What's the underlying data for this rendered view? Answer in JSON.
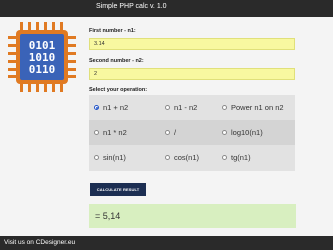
{
  "header": {
    "title": "Simple PHP calc v. 1.0"
  },
  "logo": {
    "icon": "cpu-chip-icon",
    "lines": [
      "0101",
      "1010",
      "0110"
    ]
  },
  "form": {
    "first_label": "First number - n1:",
    "first_value": "3.14",
    "second_label": "Second number - n2:",
    "second_value": "2",
    "operation_label": "Select your operation:",
    "operations": [
      {
        "label": "n1 + n2",
        "checked": true
      },
      {
        "label": "n1 - n2",
        "checked": false
      },
      {
        "label": "Power n1 on n2",
        "checked": false
      },
      {
        "label": "n1 * n2",
        "checked": false
      },
      {
        "label": "/",
        "checked": false
      },
      {
        "label": "log10(n1)",
        "checked": false
      },
      {
        "label": "sin(n1)",
        "checked": false
      },
      {
        "label": "cos(n1)",
        "checked": false
      },
      {
        "label": "tg(n1)",
        "checked": false
      }
    ],
    "calculate_label": "CALCULATE RESULT"
  },
  "result": {
    "text": "= 5,14"
  },
  "footer": {
    "prefix": "Visit us on ",
    "link": "CDesigner.eu"
  },
  "colors": {
    "topbar": "#2a2a2a",
    "input_bg": "#f8f8a0",
    "result_bg": "#d8efc0",
    "button_bg": "#1c2e52",
    "chip_body": "#3a63b8",
    "chip_pins": "#e07a22"
  }
}
